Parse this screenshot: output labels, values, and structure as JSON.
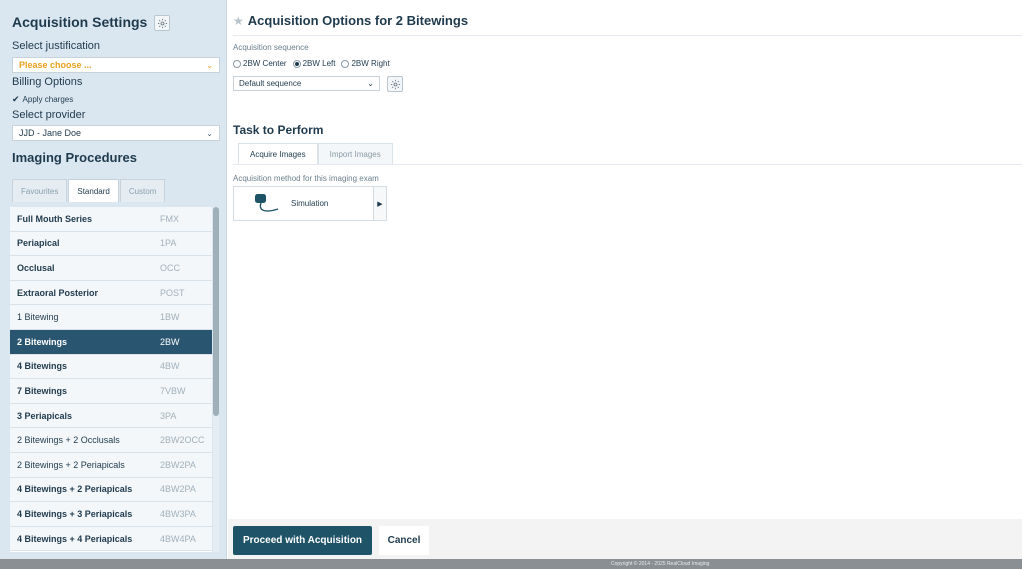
{
  "left": {
    "title": "Acquisition Settings",
    "justification_label": "Select justification",
    "justification_value": "Please choose ...",
    "billing_label": "Billing Options",
    "apply_charges_label": "Apply charges",
    "provider_label": "Select provider",
    "provider_value": "JJD - Jane Doe",
    "imaging_title": "Imaging Procedures",
    "tabs": [
      "Favourites",
      "Standard",
      "Custom"
    ],
    "active_tab": "Standard",
    "procedures": [
      {
        "name": "Full Mouth Series",
        "code": "FMX"
      },
      {
        "name": "Periapical",
        "code": "1PA"
      },
      {
        "name": "Occlusal",
        "code": "OCC"
      },
      {
        "name": "Extraoral Posterior",
        "code": "POST"
      },
      {
        "name": "1 Bitewing",
        "code": "1BW"
      },
      {
        "name": "2 Bitewings",
        "code": "2BW"
      },
      {
        "name": "4 Bitewings",
        "code": "4BW"
      },
      {
        "name": "7 Bitewings",
        "code": "7VBW"
      },
      {
        "name": "3 Periapicals",
        "code": "3PA"
      },
      {
        "name": "2 Bitewings + 2 Occlusals",
        "code": "2BW2OCC"
      },
      {
        "name": "2 Bitewings + 2 Periapicals",
        "code": "2BW2PA"
      },
      {
        "name": "4 Bitewings + 2 Periapicals",
        "code": "4BW2PA"
      },
      {
        "name": "4 Bitewings + 3 Periapicals",
        "code": "4BW3PA"
      },
      {
        "name": "4 Bitewings + 4 Periapicals",
        "code": "4BW4PA"
      }
    ],
    "selected_procedure": "2 Bitewings"
  },
  "right": {
    "title": "Acquisition Options for 2 Bitewings",
    "sequence_label": "Acquisition sequence",
    "radios": [
      {
        "label": "2BW Center",
        "checked": false
      },
      {
        "label": "2BW Left",
        "checked": true
      },
      {
        "label": "2BW Right",
        "checked": false
      }
    ],
    "sequence_value": "Default sequence",
    "task_title": "Task to Perform",
    "task_tabs": [
      "Acquire Images",
      "Import Images"
    ],
    "active_task_tab": "Acquire Images",
    "method_label": "Acquisition method for this imaging exam",
    "method_value": "Simulation",
    "proceed_label": "Proceed with Acquisition",
    "cancel_label": "Cancel"
  },
  "footer": {
    "copyright": "Copyright © 2014 - 2025 RealCloud Imaging"
  },
  "colors": {
    "accent": "#1f5468",
    "selected_row": "#2a5570",
    "placeholder_orange": "#e8a020",
    "left_panel_bg": "#dbe7f0"
  },
  "icons": {
    "settings": "gear-icon",
    "favourite": "star-icon",
    "check": "check-icon",
    "dropdown": "chevron-down-icon",
    "simulation": "sensor-icon",
    "expand": "chevron-right-icon"
  }
}
